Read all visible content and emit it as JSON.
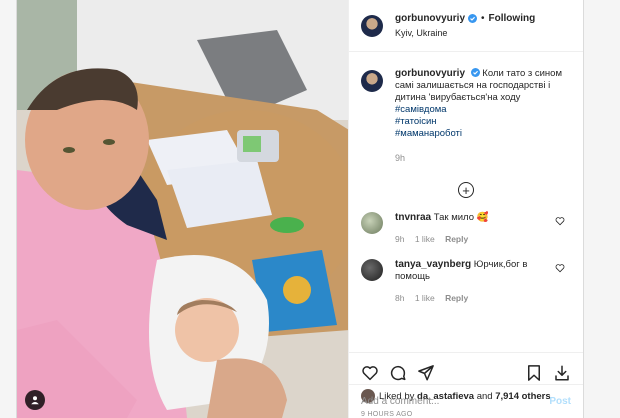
{
  "post": {
    "author": {
      "username": "gorbunovyuriy",
      "verified": true,
      "follow_state": "Following",
      "separator": "•",
      "location": "Kyiv, Ukraine"
    },
    "caption": {
      "username": "gorbunovyuriy",
      "text": "Коли тато з сином самі залишається на господарстві і дитина 'вирубається'на ходу",
      "hashtags": [
        "#самівдома",
        "#татоісин",
        "#маманароботі"
      ],
      "time": "9h"
    },
    "comments": [
      {
        "username": "tnvnraa",
        "text": "Так мило 🥰",
        "time": "9h",
        "likes": "1 like",
        "reply_label": "Reply",
        "avatar_color": "#7a8a6a"
      },
      {
        "username": "tanya_vaynberg",
        "text": "Юрчик,бог в помощь",
        "time": "8h",
        "likes": "1 like",
        "reply_label": "Reply",
        "avatar_color": "#3a3a3a"
      }
    ],
    "liked_by": {
      "prefix": "Liked by",
      "user": "da_astafieva",
      "and": "and",
      "others": "7,914 others"
    },
    "posted_ago": "9 HOURS AGO",
    "add_comment": {
      "placeholder": "Add a comment...",
      "post_label": "Post"
    },
    "icons": [
      "heart-icon",
      "comment-icon",
      "share-icon",
      "bookmark-icon",
      "download-icon",
      "user-tag-icon",
      "load-more-icon"
    ],
    "colors": {
      "link": "#00376b",
      "muted": "#8e8e8e",
      "verified": "#3897f0",
      "post_button": "#b2dffc"
    }
  }
}
